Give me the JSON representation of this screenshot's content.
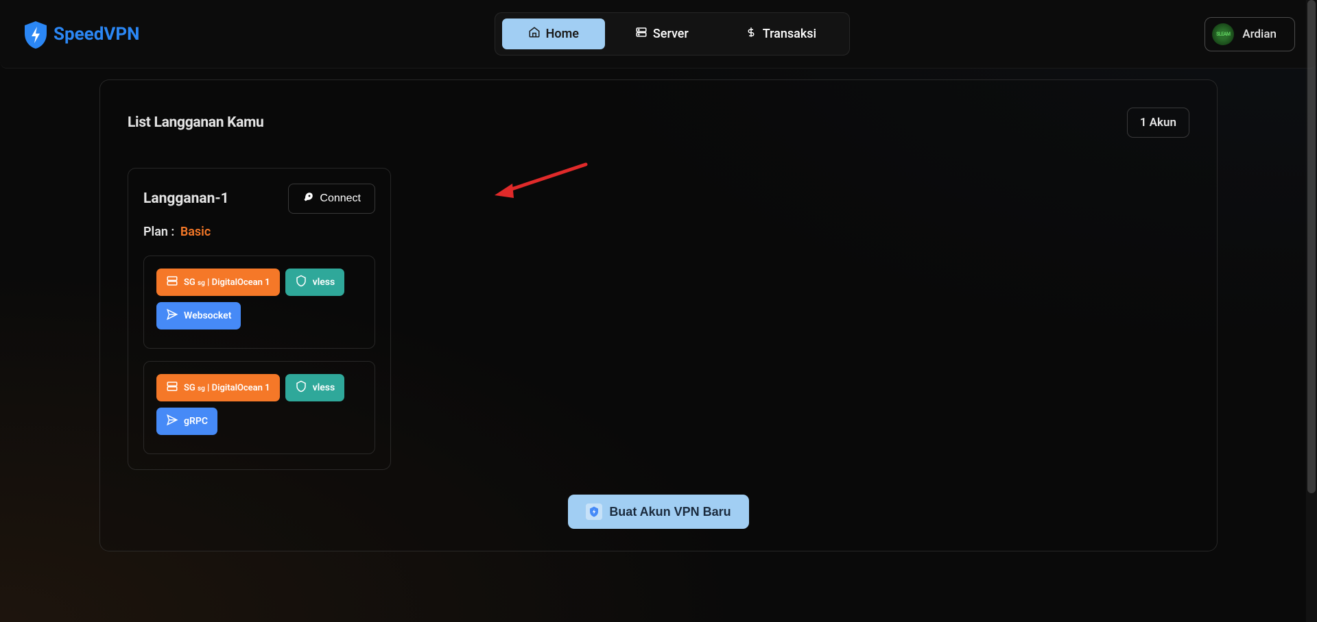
{
  "brand": {
    "name": "SpeedVPN",
    "accent": "#2b87f5"
  },
  "nav": {
    "items": [
      {
        "label": "Home",
        "icon": "home-icon",
        "active": true
      },
      {
        "label": "Server",
        "icon": "server-icon",
        "active": false
      },
      {
        "label": "Transaksi",
        "icon": "dollar-icon",
        "active": false
      }
    ]
  },
  "user": {
    "name": "Ardian",
    "avatar_text": "SLEAM"
  },
  "panel": {
    "title": "List Langganan Kamu",
    "account_count_label": "1 Akun"
  },
  "subscription": {
    "name": "Langganan-1",
    "connect_label": "Connect",
    "plan_label": "Plan :",
    "plan_value": "Basic",
    "connections": [
      {
        "server_badge_prefix": "SG",
        "server_badge_sub": "SG",
        "server_badge_name": "| DigitalOcean 1",
        "protocol": "vless",
        "transport": "Websocket"
      },
      {
        "server_badge_prefix": "SG",
        "server_badge_sub": "SG",
        "server_badge_name": "| DigitalOcean 1",
        "protocol": "vless",
        "transport": "gRPC"
      }
    ]
  },
  "create_button": "Buat Akun VPN Baru",
  "colors": {
    "orange": "#f57828",
    "teal": "#2fa89a",
    "blue": "#468af7",
    "nav_active_bg": "#a1cef3"
  }
}
